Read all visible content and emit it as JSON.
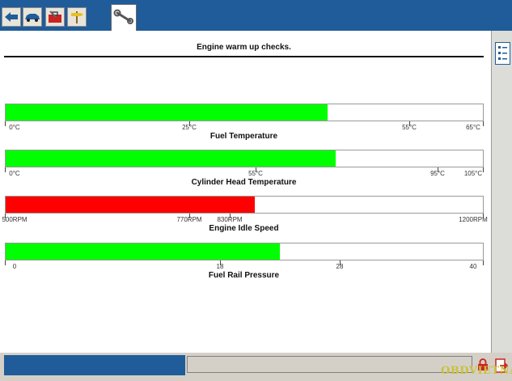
{
  "toolbar": {
    "icons": [
      "back-arrow-icon",
      "car-icon",
      "toolbox-icon",
      "signpost-icon"
    ],
    "active_tab_icon": "wrench-icon"
  },
  "title": "Engine warm up checks.",
  "gauges": [
    {
      "label": "Fuel Temperature",
      "fill_color": "#00ff00",
      "fill_fraction": 0.675,
      "ticks": [
        {
          "label": "0°C",
          "pos": 0
        },
        {
          "label": "25°C",
          "pos": 0.385
        },
        {
          "label": "55°C",
          "pos": 0.846
        },
        {
          "label": "65°C",
          "pos": 1
        }
      ]
    },
    {
      "label": "Cylinder Head Temperature",
      "fill_color": "#00ff00",
      "fill_fraction": 0.692,
      "ticks": [
        {
          "label": "0°C",
          "pos": 0
        },
        {
          "label": "55°C",
          "pos": 0.524
        },
        {
          "label": "95°C",
          "pos": 0.905
        },
        {
          "label": "105°C",
          "pos": 1
        }
      ]
    },
    {
      "label": "Engine Idle Speed",
      "fill_color": "#ff0000",
      "fill_fraction": 0.522,
      "ticks": [
        {
          "label": "500RPM",
          "pos": 0
        },
        {
          "label": "770RPM",
          "pos": 0.386
        },
        {
          "label": "830RPM",
          "pos": 0.471
        },
        {
          "label": "1200RPM",
          "pos": 1
        }
      ]
    },
    {
      "label": "Fuel Rail Pressure",
      "fill_color": "#00ff00",
      "fill_fraction": 0.574,
      "ticks": [
        {
          "label": "0",
          "pos": 0
        },
        {
          "label": "18",
          "pos": 0.45
        },
        {
          "label": "28",
          "pos": 0.7
        },
        {
          "label": "40",
          "pos": 1
        }
      ]
    }
  ],
  "status": {
    "text": "",
    "icons": [
      "lock-icon",
      "exit-icon"
    ]
  },
  "watermark": "OBDVIETNAM"
}
